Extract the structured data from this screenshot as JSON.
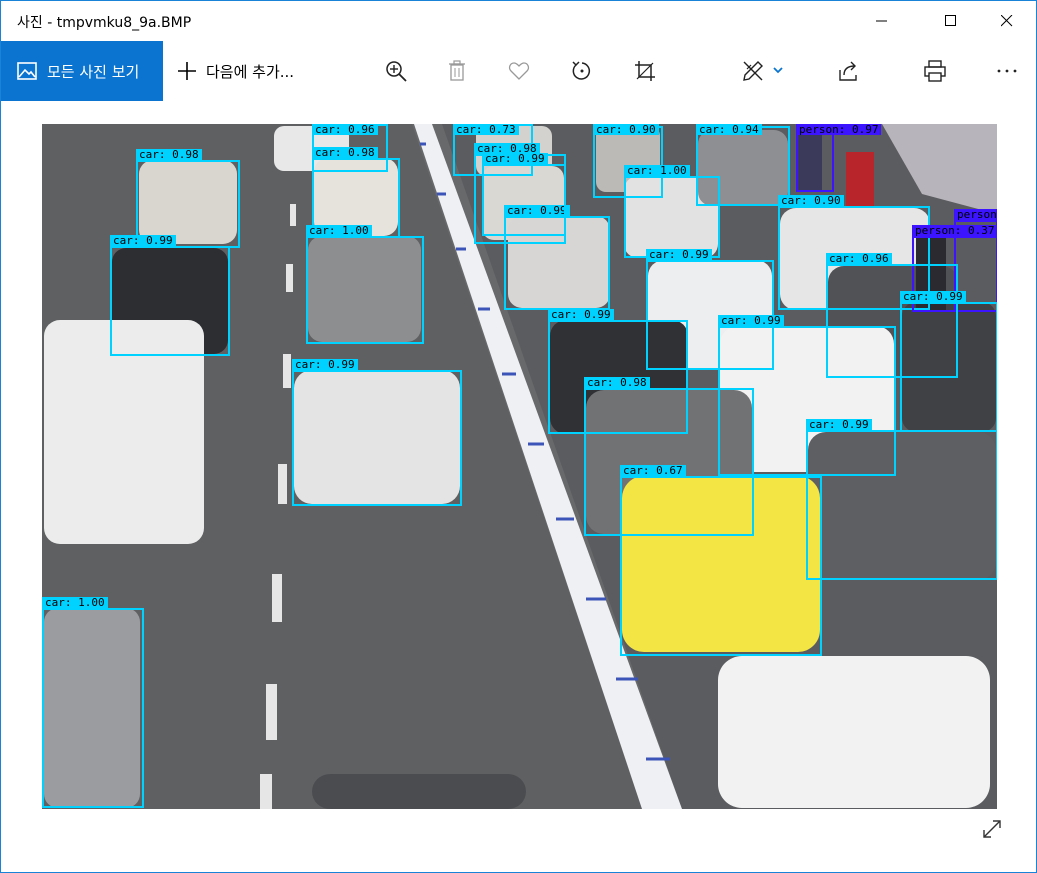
{
  "window": {
    "title": "사진 - tmpvmku8_9a.BMP",
    "controls": [
      "minimize",
      "maximize",
      "close"
    ]
  },
  "toolbar": {
    "all_photos_label": "모든 사진 보기",
    "add_to_label": "다음에 추가...",
    "tools": [
      "zoom-in-icon",
      "delete-icon",
      "favorite-icon",
      "rotate-icon",
      "crop-icon",
      "edit-draw-icon",
      "share-icon",
      "print-icon",
      "more-icon"
    ],
    "accent_color": "#0b74d1"
  },
  "detections": [
    {
      "label": "car: 0.98",
      "cls": "car"
    },
    {
      "label": "car: 0.98",
      "cls": "car"
    },
    {
      "label": "car: 0.73",
      "cls": "car"
    },
    {
      "label": "car: 0.98",
      "cls": "car"
    },
    {
      "label": "car: 0.90",
      "cls": "car"
    },
    {
      "label": "car: 0.94",
      "cls": "car"
    },
    {
      "label": "person: 0.97",
      "cls": "person"
    },
    {
      "label": "car: 1.00",
      "cls": "car"
    },
    {
      "label": "car: 0.99",
      "cls": "car"
    },
    {
      "label": "car: 1.00",
      "cls": "car"
    },
    {
      "label": "car: 0.99",
      "cls": "car"
    },
    {
      "label": "car: 0.90",
      "cls": "car"
    },
    {
      "label": "person",
      "cls": "person"
    },
    {
      "label": "person: 0.37",
      "cls": "person"
    },
    {
      "label": "car: 0.99",
      "cls": "car"
    },
    {
      "label": "car: 0.96",
      "cls": "car"
    },
    {
      "label": "car: 0.96",
      "cls": "car"
    },
    {
      "label": "car: 0.99",
      "cls": "car"
    },
    {
      "label": "car: 0.99",
      "cls": "car"
    },
    {
      "label": "car: 0.99",
      "cls": "car"
    },
    {
      "label": "car: 0.99",
      "cls": "car"
    },
    {
      "label": "car: 0.98",
      "cls": "car"
    },
    {
      "label": "car: 0.99",
      "cls": "car"
    },
    {
      "label": "car: 0.99",
      "cls": "car"
    },
    {
      "label": "car: 0.67",
      "cls": "car"
    },
    {
      "label": "car: 1.00",
      "cls": "car"
    }
  ],
  "colors": {
    "car_box": "#00d2ff",
    "person_box": "#3c14ff"
  }
}
